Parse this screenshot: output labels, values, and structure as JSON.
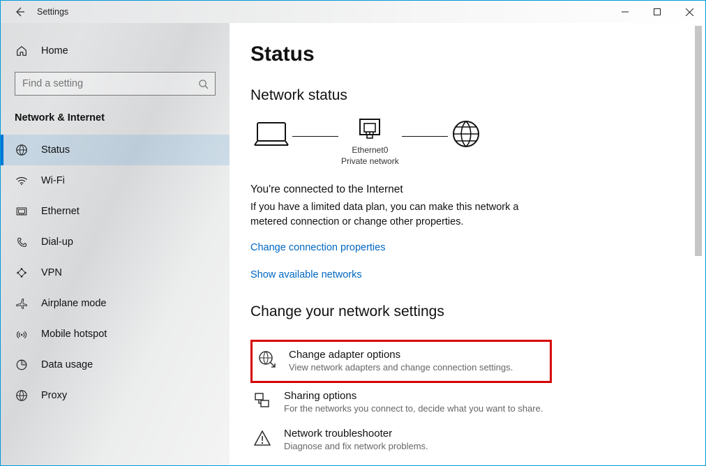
{
  "window": {
    "title": "Settings"
  },
  "sidebar": {
    "home": "Home",
    "search_placeholder": "Find a setting",
    "section": "Network & Internet",
    "items": [
      {
        "label": "Status",
        "selected": true
      },
      {
        "label": "Wi-Fi",
        "selected": false
      },
      {
        "label": "Ethernet",
        "selected": false
      },
      {
        "label": "Dial-up",
        "selected": false
      },
      {
        "label": "VPN",
        "selected": false
      },
      {
        "label": "Airplane mode",
        "selected": false
      },
      {
        "label": "Mobile hotspot",
        "selected": false
      },
      {
        "label": "Data usage",
        "selected": false
      },
      {
        "label": "Proxy",
        "selected": false
      }
    ]
  },
  "main": {
    "title": "Status",
    "network_status_heading": "Network status",
    "diagram": {
      "adapter_name": "Ethernet0",
      "adapter_type": "Private network"
    },
    "connected_heading": "You're connected to the Internet",
    "connected_desc": "If you have a limited data plan, you can make this network a metered connection or change other properties.",
    "link_props": "Change connection properties",
    "link_avail": "Show available networks",
    "change_heading": "Change your network settings",
    "options": [
      {
        "title": "Change adapter options",
        "desc": "View network adapters and change connection settings.",
        "highlight": true
      },
      {
        "title": "Sharing options",
        "desc": "For the networks you connect to, decide what you want to share.",
        "highlight": false
      },
      {
        "title": "Network troubleshooter",
        "desc": "Diagnose and fix network problems.",
        "highlight": false
      }
    ]
  }
}
